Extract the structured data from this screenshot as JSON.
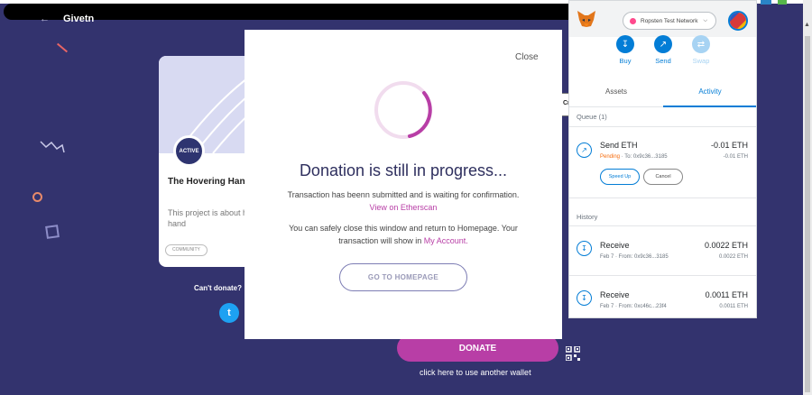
{
  "page": {
    "back_label": "Givetn",
    "card": {
      "badge": "ACTIVE",
      "title": "The Hovering Hand",
      "description": "This project is about hovering hand",
      "tag": "COMMUNITY"
    },
    "cant_donate": "Can't donate?",
    "donate_button": "DONATE",
    "wallet_link": "click here to use another wallet",
    "cr_fragment": "Cr"
  },
  "modal": {
    "close": "Close",
    "title": "Donation is still in progress...",
    "line1": "Transaction has beenn submitted and is waiting for confirmation.",
    "etherscan_link": "View on Etherscan",
    "line3": "You can safely close this window and return to Homepage. Your",
    "line4_prefix": "transaction will show in ",
    "line4_link": "My Account.",
    "home_button": "GO TO HOMEPAGE"
  },
  "metamask": {
    "network": "Ropsten Test Network",
    "actions": {
      "buy": "Buy",
      "send": "Send",
      "swap": "Swap"
    },
    "tabs": {
      "assets": "Assets",
      "activity": "Activity"
    },
    "queue_label": "Queue (1)",
    "history_label": "History",
    "queue": [
      {
        "title": "Send ETH",
        "status": "Pending",
        "detail": " · To: 0x9c36...3185",
        "amount": "-0.01 ETH",
        "amount_sub": "-0.01 ETH",
        "speed_up": "Speed Up",
        "cancel": "Cancel"
      }
    ],
    "history": [
      {
        "title": "Receive",
        "detail": "Feb 7 · From: 0x9c36...3185",
        "amount": "0.0022 ETH",
        "amount_sub": "0.0022 ETH"
      },
      {
        "title": "Receive",
        "detail": "Feb 7 · From: 0xc46c...23f4",
        "amount": "0.0011 ETH",
        "amount_sub": "0.0011 ETH"
      }
    ]
  },
  "colors": {
    "page_bg": "#33336e",
    "accent": "#b83ea6",
    "metamask_blue": "#037dd6",
    "pending": "#f66a0a"
  },
  "icons": [
    "back-arrow-icon",
    "twitter-icon",
    "qr-code-icon",
    "spinner-icon",
    "fox-logo-icon",
    "buy-icon",
    "send-icon",
    "swap-icon",
    "send-tx-icon",
    "receive-tx-icon",
    "chevron-down-icon"
  ]
}
